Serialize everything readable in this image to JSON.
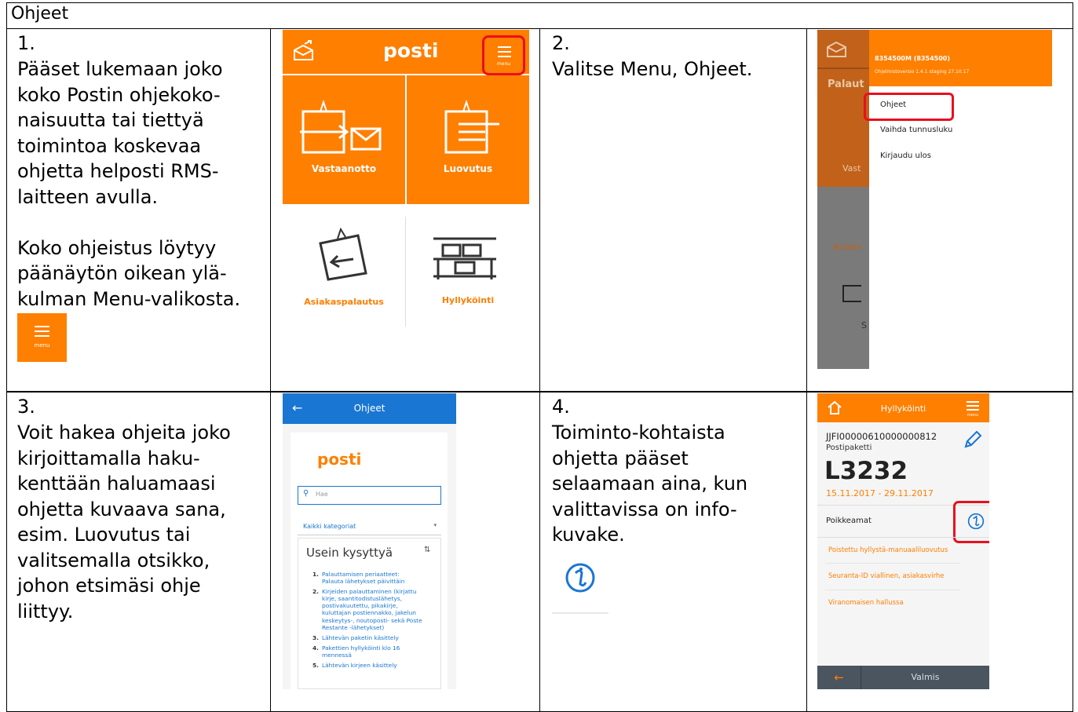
{
  "title": "Ohjeet",
  "step1": {
    "num": "1.",
    "text": "Pääset lukemaan joko\nkoko Postin ohjekoko-\nnaisuutta tai tiettyä\ntoimintoa koskevaa\nohjetta helposti RMS-\nlaitteen avulla.\n\nKoko ohjeistus löytyy\npäänäytön oikean ylä-\nkulman Menu-valikosta.",
    "menu_icon_label": "menu"
  },
  "step2": {
    "num": "2.",
    "text": "Valitse Menu, Ohjeet."
  },
  "step3": {
    "num": "3.",
    "text": "Voit hakea ohjeita joko\nkirjoittamalla haku-\nkenttään haluamaasi\nohjetta kuvaava sana,\nesim. Luovutus tai\nvalitsemalla otsikko,\njohon etsimäsi ohje\nliittyy."
  },
  "step4": {
    "num": "4.",
    "text": "Toiminto-kohtaista\nohjetta pääset\nselaamaan aina, kun\nvalittavissa on info-\nkuvake."
  },
  "shot1": {
    "logo": "posti",
    "menu_label": "menu",
    "tile1": "Vastaanotto",
    "tile2": "Luovutus",
    "tile3": "Asiakaspalautus",
    "tile4": "Hyllyköinti"
  },
  "shot2": {
    "account": "8354500M (8354500)",
    "version": "Ohjelmistoversio 1.4.1 staging 27.10.17",
    "side1": "Palaut",
    "side2": "Vast",
    "side3": "Asiaka",
    "side4": "S",
    "menu_items": [
      "Ohjeet",
      "Vaihda tunnusluku",
      "Kirjaudu ulos"
    ]
  },
  "shot3": {
    "header": "Ohjeet",
    "logo": "posti",
    "search_placeholder": "Hae",
    "category": "Kaikki kategoriat",
    "faq_title": "Usein kysyttyä",
    "faq": [
      {
        "n": "1.",
        "t": "Palauttamisen periaatteet:\nPalauta lähetykset päivittäin"
      },
      {
        "n": "2.",
        "t": "Kirjeiden palauttaminen (kirjattu\nkirje, saantitodistuslähetys,\npostivakuutettu, pikakirje,\nkuluttajan postiennakko, jakelun\nkeskeytys-, noutoposti- sekä Poste\nRestante -lähetykset)"
      },
      {
        "n": "3.",
        "t": "Lähtevän paketin käsittely"
      },
      {
        "n": "4.",
        "t": "Pakettien hyllyköinti klo 16\nmennessä"
      },
      {
        "n": "5.",
        "t": "Lähtevän kirjeen käsittely"
      }
    ]
  },
  "shot4": {
    "header": "Hyllyköinti",
    "menu_label": "menu",
    "id": "JJFI00000610000000812",
    "type": "Postipaketti",
    "shelf": "L3232",
    "dates": "15.11.2017 - 29.11.2017",
    "section": "Poikkeamat",
    "items": [
      "Poistettu hyllystä-manuaaliluovutus",
      "Seuranta-ID viallinen, asiakasvirhe",
      "Viranomaisen hallussa"
    ],
    "done": "Valmis"
  },
  "colors": {
    "orange": "#ff7f00",
    "highlight": "#e8101e",
    "blue": "#1976d2"
  }
}
